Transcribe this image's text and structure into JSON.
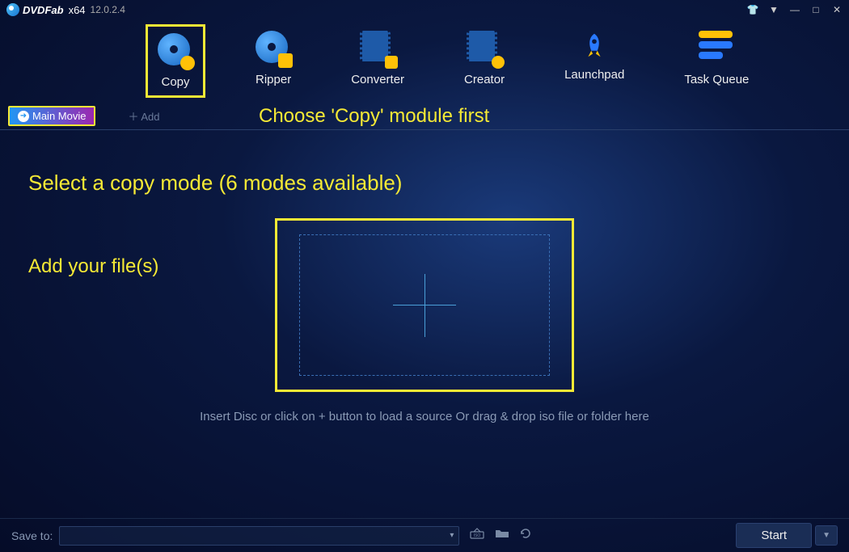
{
  "titlebar": {
    "app_name": "DVDFab",
    "arch": "x64",
    "version": "12.0.2.4"
  },
  "modules": [
    {
      "label": "Copy",
      "active": true
    },
    {
      "label": "Ripper",
      "active": false
    },
    {
      "label": "Converter",
      "active": false
    },
    {
      "label": "Creator",
      "active": false
    },
    {
      "label": "Launchpad",
      "active": false
    },
    {
      "label": "Task Queue",
      "active": false
    }
  ],
  "secondary": {
    "main_movie_label": "Main Movie",
    "add_label": "Add",
    "choose_hint": "Choose 'Copy' module first"
  },
  "main": {
    "select_mode_label": "Select a copy mode (6 modes available)",
    "add_files_label": "Add your file(s)",
    "hint_text": "Insert Disc or click on + button to load a source Or drag & drop iso file or folder here"
  },
  "footer": {
    "save_label": "Save to:",
    "start_label": "Start"
  }
}
